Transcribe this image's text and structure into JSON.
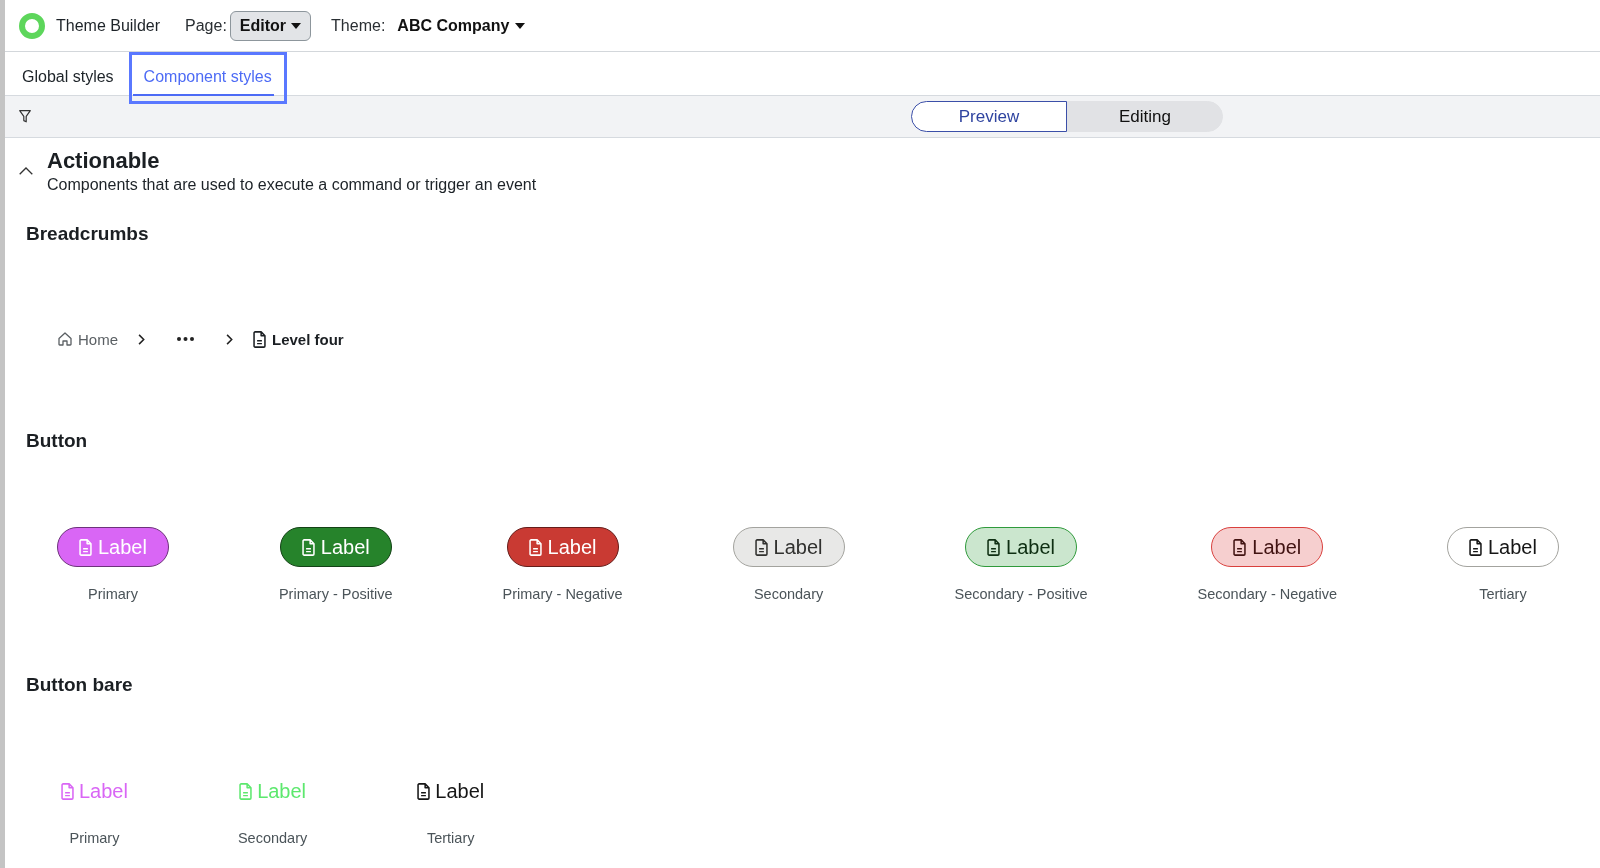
{
  "header": {
    "app_title": "Theme Builder",
    "page_label": "Page:",
    "page_value": "Editor",
    "theme_label": "Theme:",
    "theme_value": "ABC Company"
  },
  "tabs": [
    {
      "label": "Global styles",
      "selected": false,
      "focused": false
    },
    {
      "label": "Component styles",
      "selected": true,
      "focused": true
    }
  ],
  "toolbar": {
    "modes": [
      {
        "label": "Preview",
        "selected": true
      },
      {
        "label": "Editing",
        "selected": false
      }
    ]
  },
  "section": {
    "title": "Actionable",
    "description": "Components that are used to execute a command or trigger an event",
    "expanded": true,
    "groups": [
      {
        "kind": "breadcrumbs",
        "title": "Breadcrumbs",
        "items": [
          {
            "kind": "home",
            "label": "Home",
            "current": false
          },
          {
            "kind": "overflow"
          },
          {
            "kind": "page",
            "label": "Level four",
            "current": true
          }
        ]
      },
      {
        "kind": "buttons",
        "title": "Button",
        "items": [
          {
            "kind": "filled",
            "label": "Label",
            "caption": "Primary",
            "color": "#d966f5"
          },
          {
            "kind": "filled",
            "label": "Label",
            "caption": "Primary - Positive",
            "color": "#26832b"
          },
          {
            "kind": "filled",
            "label": "Label",
            "caption": "Primary - Negative",
            "color": "#c93a33"
          },
          {
            "kind": "tinted",
            "label": "Label",
            "caption": "Secondary",
            "color": "#a3a39e"
          },
          {
            "kind": "tinted",
            "label": "Label",
            "caption": "Secondary - Positive",
            "color": "#2f9a3b"
          },
          {
            "kind": "tinted",
            "label": "Label",
            "caption": "Secondary - Negative",
            "color": "#d9403d"
          },
          {
            "kind": "outline",
            "label": "Label",
            "caption": "Tertiary",
            "color": "#a3a39e"
          }
        ]
      },
      {
        "kind": "bare",
        "title": "Button bare",
        "items": [
          {
            "label": "Label",
            "caption": "Primary",
            "color": "#d966f5"
          },
          {
            "label": "Label",
            "caption": "Secondary",
            "color": "#5de86e"
          },
          {
            "label": "Label",
            "caption": "Tertiary",
            "color": "#161616"
          }
        ]
      }
    ]
  }
}
